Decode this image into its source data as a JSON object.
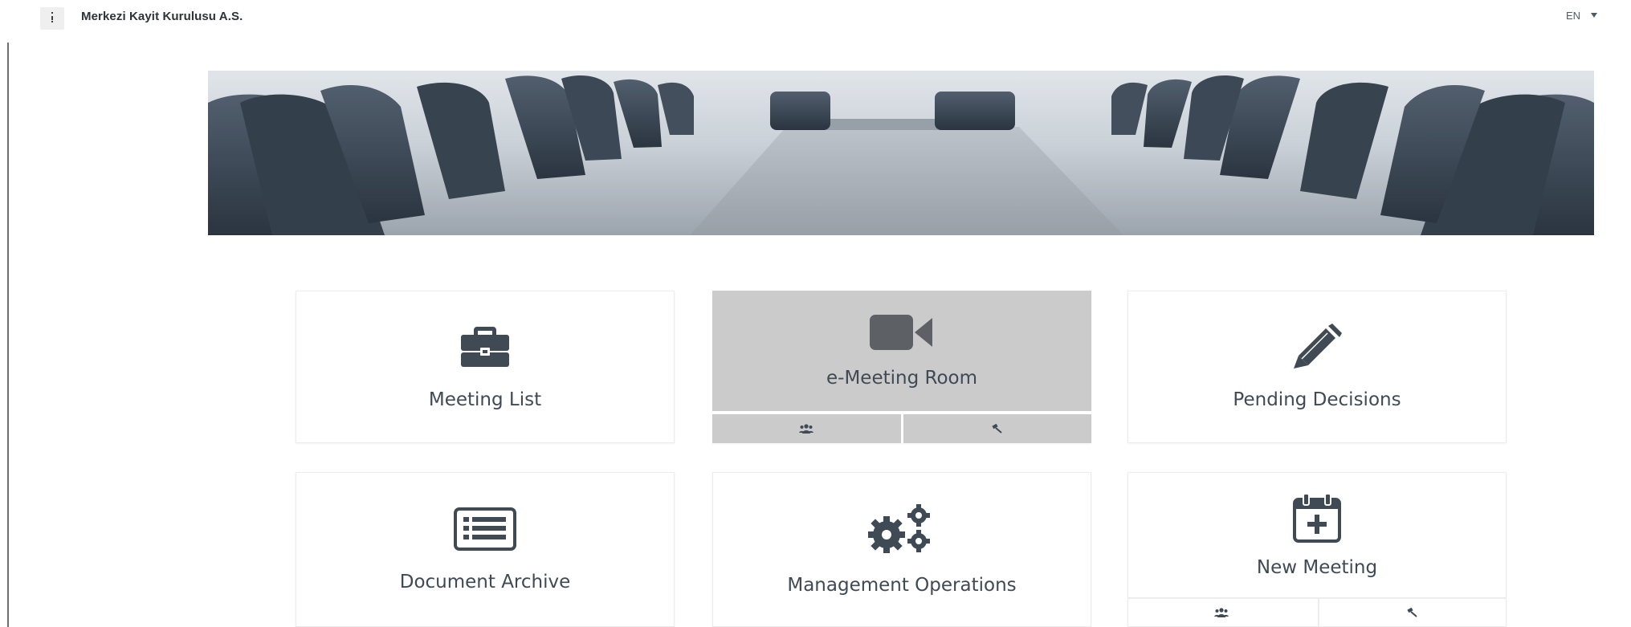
{
  "header": {
    "company_name": "Merkezi Kayit Kurulusu A.S.",
    "language": "EN",
    "menu_icon": "vertical-ellipsis-icon",
    "language_caret_icon": "caret-down-icon"
  },
  "banner": {
    "image": "boardroom-chairs-photo"
  },
  "tiles": [
    {
      "label": "Meeting List",
      "icon": "briefcase-icon",
      "active": false
    },
    {
      "label": "e-Meeting Room",
      "icon": "video-camera-icon",
      "active": true,
      "sub_actions": [
        {
          "icon": "users-icon"
        },
        {
          "icon": "gavel-icon"
        }
      ]
    },
    {
      "label": "Pending Decisions",
      "icon": "pencil-icon",
      "active": false
    },
    {
      "label": "Document Archive",
      "icon": "list-document-icon",
      "active": false
    },
    {
      "label": "Management Operations",
      "icon": "cogs-icon",
      "active": false
    },
    {
      "label": "New Meeting",
      "icon": "calendar-plus-icon",
      "active": false,
      "sub_actions": [
        {
          "icon": "users-icon"
        },
        {
          "icon": "gavel-icon"
        }
      ]
    }
  ],
  "colors": {
    "icon_dark": "#3f4a55",
    "active_tile": "#cbcbcb",
    "text": "#3f4a55"
  }
}
